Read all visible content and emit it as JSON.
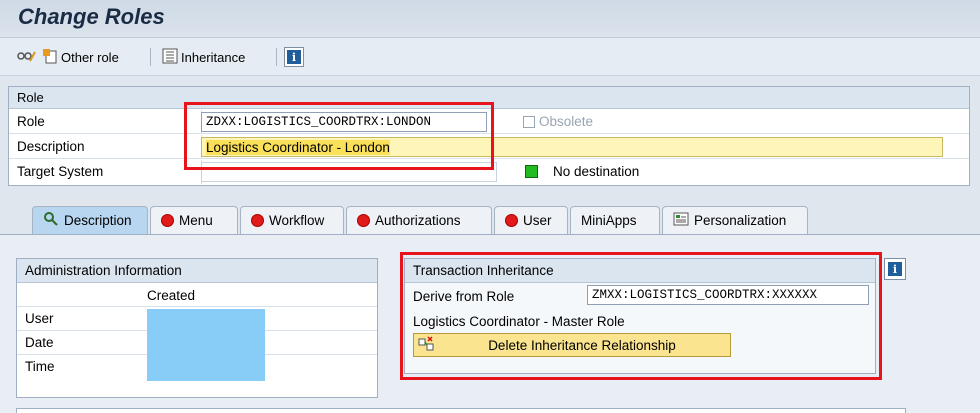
{
  "page": {
    "title": "Change Roles"
  },
  "toolbar": {
    "other_role_label": "Other role",
    "inheritance_label": "Inheritance",
    "info_icon": "i"
  },
  "role_panel": {
    "header": "Role",
    "role_label": "Role",
    "role_value": "ZDXX:LOGISTICS_COORDTRX:LONDON",
    "obsolete_label": "Obsolete",
    "description_label": "Description",
    "description_value": "Logistics Coordinator - London",
    "target_system_label": "Target System",
    "destination_status": "No destination",
    "destination_status_color": "#22bb22"
  },
  "tabs": [
    {
      "label": "Description",
      "icon": "description-icon",
      "active": true
    },
    {
      "label": "Menu",
      "icon": "red-status-icon"
    },
    {
      "label": "Workflow",
      "icon": "red-status-icon"
    },
    {
      "label": "Authorizations",
      "icon": "red-status-icon"
    },
    {
      "label": "User",
      "icon": "red-status-icon"
    },
    {
      "label": "MiniApps",
      "icon": ""
    },
    {
      "label": "Personalization",
      "icon": "personalization-icon"
    }
  ],
  "admin": {
    "header": "Administration Information",
    "created_label": "Created",
    "user_label": "User",
    "date_label": "Date",
    "time_label": "Time",
    "value_color": "#87cdf7"
  },
  "inheritance": {
    "header": "Transaction Inheritance",
    "derive_label": "Derive from Role",
    "derive_value": "ZMXX:LOGISTICS_COORDTRX:XXXXXX",
    "master_role_text": "Logistics Coordinator - Master Role",
    "delete_button": "Delete Inheritance Relationship"
  },
  "colors": {
    "highlight": "#e8141b",
    "accent": "#b8d6f0"
  }
}
